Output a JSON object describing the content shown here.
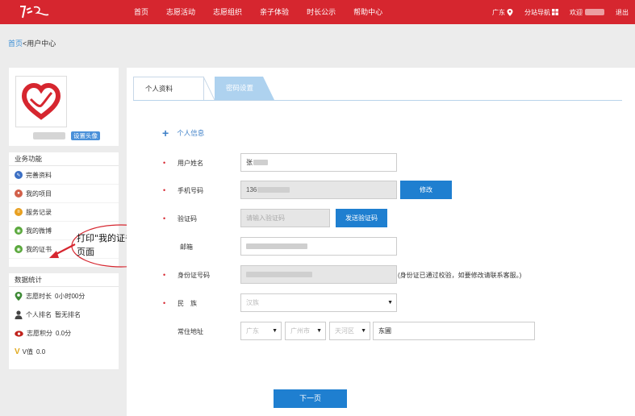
{
  "nav": {
    "items": [
      "首页",
      "志愿活动",
      "志愿组织",
      "亲子体验",
      "时长公示",
      "帮助中心"
    ],
    "location": "广东",
    "station_nav": "分站导航",
    "welcome": "欢迎",
    "logout": "退出"
  },
  "breadcrumb": {
    "home": "首页",
    "separator": "<",
    "current": "用户中心"
  },
  "profile": {
    "set_avatar": "设置头像"
  },
  "business": {
    "title": "业务功能",
    "items": [
      {
        "label": "完善资料",
        "icon": "pencil-icon",
        "color": "#3b6fc4"
      },
      {
        "label": "我的项目",
        "icon": "people-icon",
        "color": "#d2604a"
      },
      {
        "label": "服务记录",
        "icon": "record-icon",
        "color": "#e8a020"
      },
      {
        "label": "我的微博",
        "icon": "weibo-icon",
        "color": "#5aa83c"
      },
      {
        "label": "我的证书",
        "icon": "certificate-icon",
        "color": "#5aa83c"
      }
    ]
  },
  "stats": {
    "title": "数据统计",
    "items": [
      {
        "label": "志愿时长",
        "value": "0小时00分",
        "icon": "location-pin-icon"
      },
      {
        "label": "个人排名",
        "value": "暂无排名",
        "icon": "person-icon"
      },
      {
        "label": "志愿积分",
        "value": "0.0分",
        "icon": "eye-icon"
      },
      {
        "label": "V值",
        "value": "0.0",
        "icon": "v-icon"
      }
    ]
  },
  "annotation": {
    "line1": "打印\"我的证书\"",
    "line2": "页面"
  },
  "tabs": {
    "profile": "个人资料",
    "password": "密码设置"
  },
  "form": {
    "section_title": "个人信息",
    "username": {
      "label": "用户姓名",
      "value": "张"
    },
    "phone": {
      "label": "手机号码",
      "value": "136",
      "button": "修改"
    },
    "code": {
      "label": "验证码",
      "placeholder": "请输入验证码",
      "button": "发送验证码"
    },
    "email": {
      "label": "邮箱"
    },
    "id_card": {
      "label": "身份证号码",
      "hint": "(身份证已通过校验，如要修改请联系客服。)"
    },
    "ethnicity": {
      "label": "民　族",
      "value": "汉族"
    },
    "address": {
      "label": "常住地址",
      "province": "广东",
      "city": "广州市",
      "district": "天河区",
      "detail": "东圃"
    },
    "next": "下一页"
  },
  "colors": {
    "brand": "#d6262f",
    "accent": "#1f7fd0",
    "tab_inactive": "#aed2ef"
  }
}
